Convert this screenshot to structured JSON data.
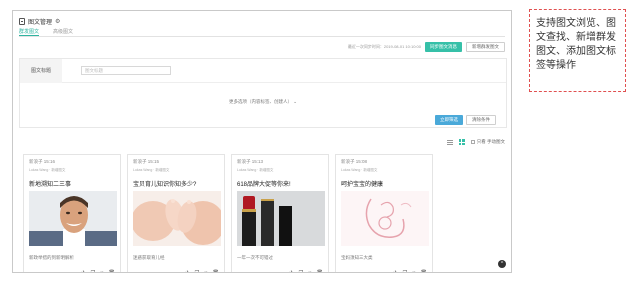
{
  "header": {
    "title": "图文管理"
  },
  "tabs": [
    {
      "label": "群发图文",
      "active": true
    },
    {
      "label": "高级图文",
      "active": false
    }
  ],
  "toolbar": {
    "sync_text": "最近一次同步时间：2019-08-01 10:10:00",
    "sync_button": "同步图文消息",
    "new_button": "新增群发图文"
  },
  "filter": {
    "label": "图文标题",
    "placeholder": "图文标题",
    "more": "更多选项（内容标签、创建人） ⌄",
    "search_button": "立即筛选",
    "clear_button": "清除条件"
  },
  "view": {
    "only_mine": "只看 手动图文"
  },
  "cards": [
    {
      "meta1": "新浪子 15:16",
      "meta2": "Lukas Wang · 新增图文",
      "title": "新地溯知二三事",
      "desc": "新政举措的到新明解析",
      "image": "man"
    },
    {
      "meta1": "新浪子 15:15",
      "meta2": "Lukas Wang · 新增图文",
      "title": "宝贝育儿知识你知多少?",
      "desc": "迷惑获取育儿经",
      "image": "feet"
    },
    {
      "meta1": "新浪子 15:13",
      "meta2": "Lukas Wang · 新增图文",
      "title": "618品牌大促等你来!",
      "desc": "一年一次不可错过",
      "image": "lipstick"
    },
    {
      "meta1": "新浪子 15:08",
      "meta2": "Lukas Wang · 新增图文",
      "title": "呵护宝宝的健康",
      "desc": "宝妈须知三大类",
      "image": "mother"
    }
  ],
  "callout": {
    "text": "支持图文浏览、图文查找、新增群发图文、添加图文标签等操作"
  },
  "colors": {
    "accent": "#36c0a8",
    "blue": "#4aa9d9",
    "callout_border": "#e05050"
  }
}
